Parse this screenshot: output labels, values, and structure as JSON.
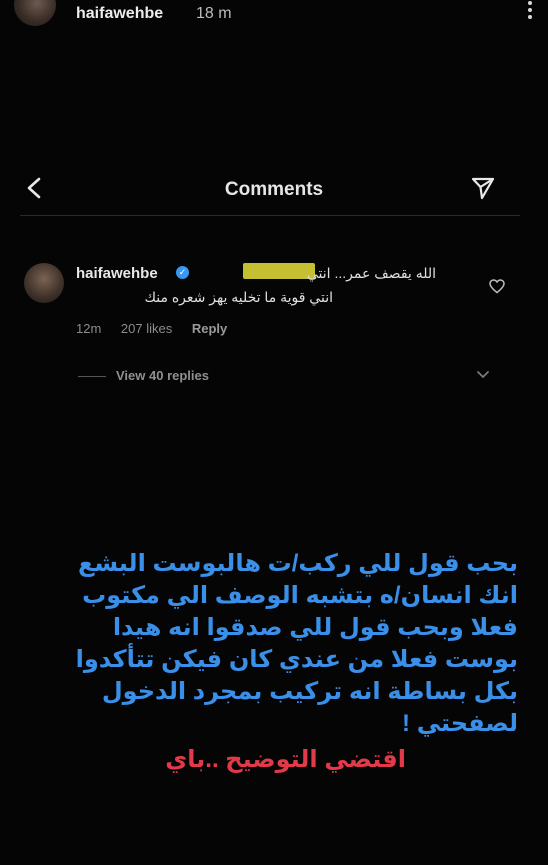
{
  "story": {
    "username": "haifawehbe",
    "time": "18 m"
  },
  "comments_header": {
    "title": "Comments"
  },
  "comment": {
    "username": "haifawehbe",
    "line1": "الله يقصف عمر... انتي",
    "line2": "انتي قوية ما تخليه يهز شعره منك",
    "time": "12m",
    "likes": "207 likes",
    "reply": "Reply",
    "view_replies": "View 40 replies"
  },
  "overlay": {
    "lines": [
      "بحب قول للي ركب/ت هالبوست البشع",
      "انك انسان/ه بتشبه الوصف الي مكتوب",
      "فعلا وبحب قول للي صدقوا انه هيدا",
      "بوست فعلا من عندي كان فيكن تتأكدوا",
      "بكل بساطة انه تركيب بمجرد الدخول",
      "لصفحتي !"
    ],
    "closing": "اقتضي التوضيح ..باي",
    "colors": {
      "main": "#3a8fe8",
      "closing": "#e33a4a"
    }
  },
  "icons": [
    "back-icon",
    "send-icon",
    "heart-icon",
    "verified-badge-icon",
    "chevron-down-icon",
    "more-icon"
  ]
}
